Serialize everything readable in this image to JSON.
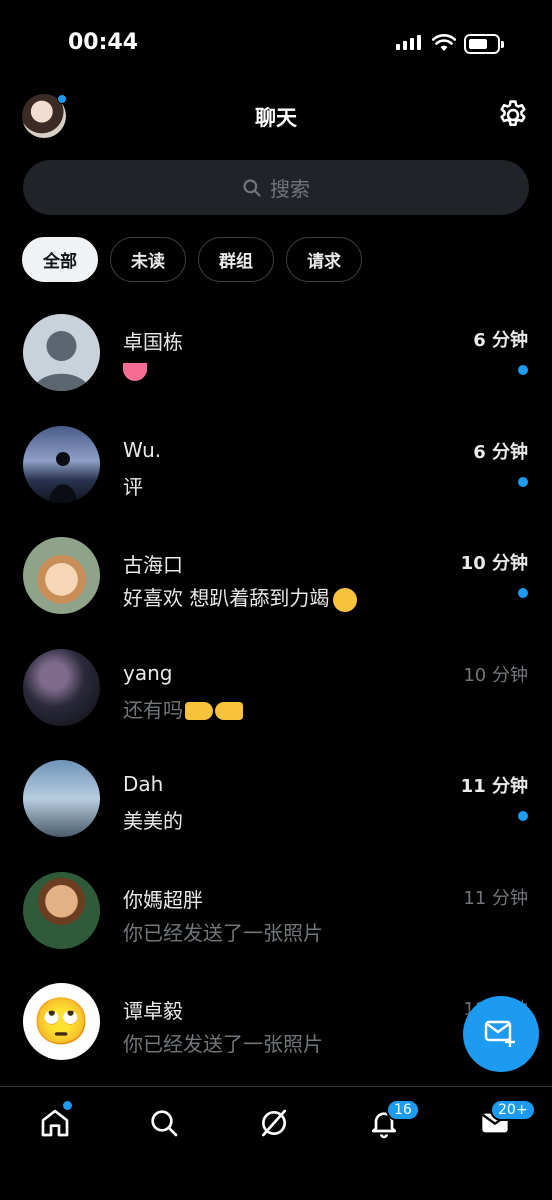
{
  "status_bar": {
    "time": "00:44"
  },
  "header": {
    "title": "聊天"
  },
  "search": {
    "placeholder": "搜索"
  },
  "filters": [
    {
      "label": "全部",
      "active": true
    },
    {
      "label": "未读",
      "active": false
    },
    {
      "label": "群组",
      "active": false
    },
    {
      "label": "请求",
      "active": false
    }
  ],
  "chats": [
    {
      "name": "卓国栋",
      "preview": "",
      "time": "6 分钟",
      "unread": true,
      "emoji": "tongue"
    },
    {
      "name": "Wu.",
      "preview": "评",
      "time": "6 分钟",
      "unread": true
    },
    {
      "name": "古海口",
      "preview": "好喜欢 想趴着舔到力竭",
      "time": "10 分钟",
      "unread": true,
      "emoji": "persevering-face"
    },
    {
      "name": "yang",
      "preview": "还有吗",
      "time": "10 分钟",
      "unread": false,
      "emoji": "pointing-hands"
    },
    {
      "name": "Dah",
      "preview": "美美的",
      "time": "11 分钟",
      "unread": true
    },
    {
      "name": "你媽超胖",
      "preview": "你已经发送了一张照片",
      "time": "11 分钟",
      "unread": false
    },
    {
      "name": "谭卓毅",
      "preview": "你已经发送了一张照片",
      "time": "11 分钟",
      "unread": false,
      "avatar_emoji": "🙄"
    }
  ],
  "bottom_nav": {
    "home_icon": "home-icon",
    "notifications_badge": "16",
    "messages_badge": "20+"
  },
  "colors": {
    "accent": "#1d9bf0",
    "background": "#000000",
    "muted": "#71767b"
  }
}
